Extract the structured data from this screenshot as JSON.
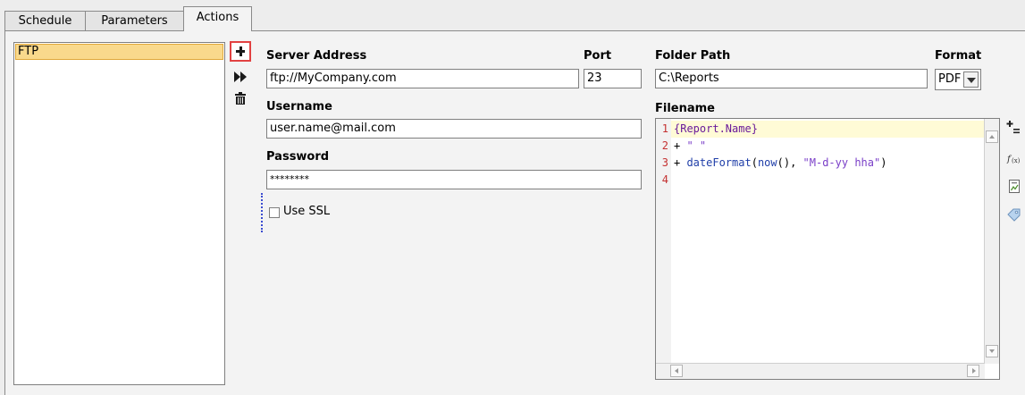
{
  "tabs": [
    {
      "label": "Schedule"
    },
    {
      "label": "Parameters"
    },
    {
      "label": "Actions"
    }
  ],
  "actions_list": {
    "items": [
      {
        "label": "FTP",
        "selected": true
      }
    ]
  },
  "toolbar": {
    "add_icon": "plus-icon",
    "forward_icon": "fast-forward-icon",
    "delete_icon": "trash-icon"
  },
  "form": {
    "server_address": {
      "label": "Server Address",
      "value": "ftp://MyCompany.com"
    },
    "port": {
      "label": "Port",
      "value": "23"
    },
    "username": {
      "label": "Username",
      "value": "user.name@mail.com"
    },
    "password": {
      "label": "Password",
      "value": "********"
    },
    "use_ssl": {
      "label": "Use SSL",
      "checked": false
    },
    "folder_path": {
      "label": "Folder Path",
      "value": "C:\\Reports"
    },
    "format": {
      "label": "Format",
      "value": "PDF"
    },
    "filename": {
      "label": "Filename",
      "lines": [
        {
          "number": "1",
          "tokens": [
            {
              "t": "{Report.Name}",
              "k": "ident"
            }
          ]
        },
        {
          "number": "2",
          "tokens": [
            {
              "t": "+ ",
              "k": "op"
            },
            {
              "t": "\" \"",
              "k": "str"
            }
          ]
        },
        {
          "number": "3",
          "tokens": [
            {
              "t": "+ ",
              "k": "op"
            },
            {
              "t": "dateFormat",
              "k": "fn"
            },
            {
              "t": "(",
              "k": "op"
            },
            {
              "t": "now",
              "k": "fn"
            },
            {
              "t": "(), ",
              "k": "op"
            },
            {
              "t": "\"M-d-yy hha\"",
              "k": "str"
            },
            {
              "t": ")",
              "k": "op"
            }
          ]
        },
        {
          "number": "4",
          "tokens": []
        }
      ]
    }
  },
  "editor_tools": [
    {
      "icon": "insert-field-icon"
    },
    {
      "icon": "function-icon"
    },
    {
      "icon": "report-icon"
    },
    {
      "icon": "tag-icon"
    }
  ],
  "colors": {
    "selection": "#f9d98c",
    "highlight_border": "#e24242",
    "gutter_numbers": "#c43131"
  }
}
